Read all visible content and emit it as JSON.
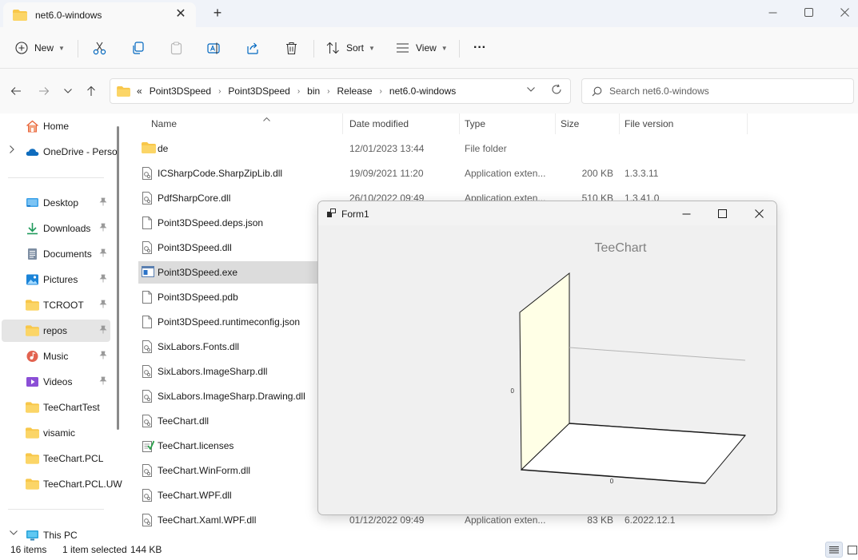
{
  "window": {
    "tab_title": "net6.0-windows",
    "new_tab_glyph": "+",
    "close_glyph": "✕"
  },
  "toolbar": {
    "new_label": "New",
    "sort_label": "Sort",
    "view_label": "View",
    "more_glyph": "···"
  },
  "address": {
    "overflow": "«",
    "crumbs": [
      "Point3DSpeed",
      "Point3DSpeed",
      "bin",
      "Release",
      "net6.0-windows"
    ],
    "search_placeholder": "Search net6.0-windows"
  },
  "sidebar": {
    "items": [
      {
        "label": "Home",
        "icon": "home-icon",
        "pinned": false
      },
      {
        "label": "OneDrive - Perso",
        "icon": "cloud-icon",
        "pinned": false
      },
      {
        "label": "Desktop",
        "icon": "desktop-icon",
        "pinned": true
      },
      {
        "label": "Downloads",
        "icon": "download-icon",
        "pinned": true
      },
      {
        "label": "Documents",
        "icon": "document-icon",
        "pinned": true
      },
      {
        "label": "Pictures",
        "icon": "picture-icon",
        "pinned": true
      },
      {
        "label": "TCROOT",
        "icon": "folder-icon",
        "pinned": true
      },
      {
        "label": "repos",
        "icon": "folder-icon",
        "pinned": true
      },
      {
        "label": "Music",
        "icon": "music-icon",
        "pinned": true
      },
      {
        "label": "Videos",
        "icon": "video-icon",
        "pinned": true
      },
      {
        "label": "TeeChartTest",
        "icon": "folder-icon",
        "pinned": false
      },
      {
        "label": "visamic",
        "icon": "folder-icon",
        "pinned": false
      },
      {
        "label": "TeeChart.PCL",
        "icon": "folder-icon",
        "pinned": false
      },
      {
        "label": "TeeChart.PCL.UW",
        "icon": "folder-icon",
        "pinned": false
      },
      {
        "label": "This PC",
        "icon": "pc-icon",
        "pinned": false
      }
    ],
    "pin_glyph": "📌"
  },
  "columns": {
    "name": "Name",
    "date": "Date modified",
    "type": "Type",
    "size": "Size",
    "version": "File version"
  },
  "files": [
    {
      "name": "de",
      "date": "12/01/2023 13:44",
      "type": "File folder",
      "size": "",
      "version": "",
      "icon": "folder-icon"
    },
    {
      "name": "ICSharpCode.SharpZipLib.dll",
      "date": "19/09/2021 11:20",
      "type": "Application exten...",
      "size": "200 KB",
      "version": "1.3.3.11",
      "icon": "dll-file-icon"
    },
    {
      "name": "PdfSharpCore.dll",
      "date": "26/10/2022 09:49",
      "type": "Application exten...",
      "size": "510 KB",
      "version": "1.3.41.0",
      "icon": "dll-file-icon"
    },
    {
      "name": "Point3DSpeed.deps.json",
      "date": "",
      "type": "",
      "size": "",
      "version": "",
      "icon": "file-icon"
    },
    {
      "name": "Point3DSpeed.dll",
      "date": "",
      "type": "",
      "size": "",
      "version": "",
      "icon": "dll-file-icon"
    },
    {
      "name": "Point3DSpeed.exe",
      "date": "",
      "type": "",
      "size": "",
      "version": "",
      "icon": "exe-file-icon"
    },
    {
      "name": "Point3DSpeed.pdb",
      "date": "",
      "type": "",
      "size": "",
      "version": "",
      "icon": "file-icon"
    },
    {
      "name": "Point3DSpeed.runtimeconfig.json",
      "date": "",
      "type": "",
      "size": "",
      "version": "",
      "icon": "file-icon"
    },
    {
      "name": "SixLabors.Fonts.dll",
      "date": "",
      "type": "",
      "size": "",
      "version": "",
      "icon": "dll-file-icon"
    },
    {
      "name": "SixLabors.ImageSharp.dll",
      "date": "",
      "type": "",
      "size": "",
      "version": "",
      "icon": "dll-file-icon"
    },
    {
      "name": "SixLabors.ImageSharp.Drawing.dll",
      "date": "",
      "type": "",
      "size": "",
      "version": "",
      "icon": "dll-file-icon"
    },
    {
      "name": "TeeChart.dll",
      "date": "",
      "type": "",
      "size": "",
      "version": "",
      "icon": "dll-file-icon"
    },
    {
      "name": "TeeChart.licenses",
      "date": "",
      "type": "",
      "size": "",
      "version": "",
      "icon": "license-file-icon"
    },
    {
      "name": "TeeChart.WinForm.dll",
      "date": "",
      "type": "",
      "size": "",
      "version": "",
      "icon": "dll-file-icon"
    },
    {
      "name": "TeeChart.WPF.dll",
      "date": "",
      "type": "",
      "size": "",
      "version": "",
      "icon": "dll-file-icon"
    },
    {
      "name": "TeeChart.Xaml.WPF.dll",
      "date": "01/12/2022 09:49",
      "type": "Application exten...",
      "size": "83 KB",
      "version": "6.2022.12.1",
      "icon": "dll-file-icon"
    }
  ],
  "status": {
    "items": "16 items",
    "selected": "1 item selected",
    "size": "144 KB"
  },
  "form1": {
    "title": "Form1",
    "chart_title": "TeeChart",
    "left_axis_label": "0",
    "bottom_axis_label": "0",
    "wall_color": "#ffffe6",
    "floor_color": "#ffffff"
  },
  "colors": {
    "folder": "#f8c74a",
    "accent": "#0067c0",
    "selected_row": "#dcdcdc"
  }
}
